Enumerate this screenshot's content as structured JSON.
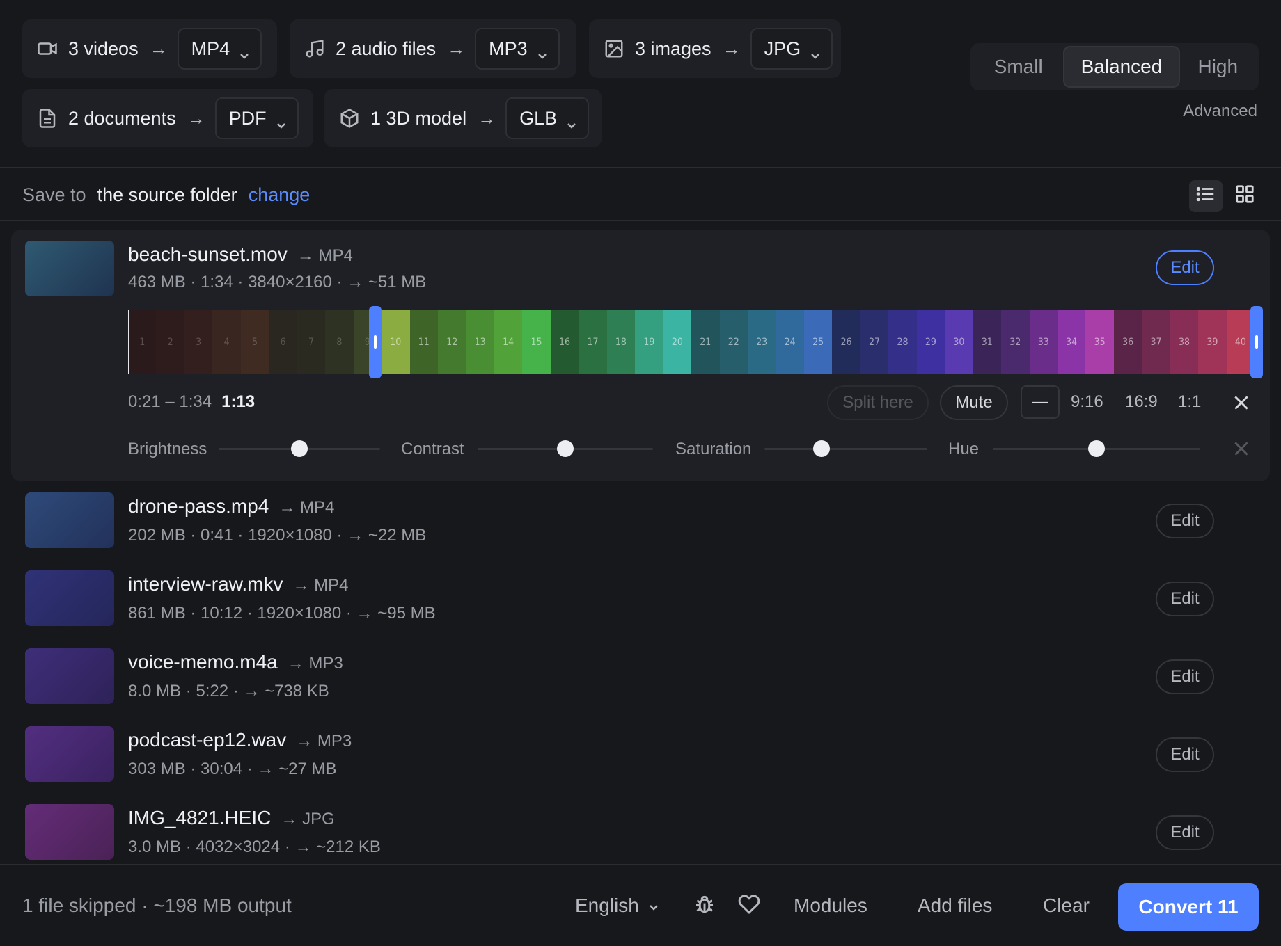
{
  "groups": [
    {
      "label": "3 videos",
      "arrow": "→",
      "format": "MP4",
      "icon": "video-icon"
    },
    {
      "label": "2 audio files",
      "arrow": "→",
      "format": "MP3",
      "icon": "music-note-icon"
    },
    {
      "label": "3 images",
      "arrow": "→",
      "format": "JPG",
      "icon": "image-icon"
    },
    {
      "label": "2 documents",
      "arrow": "→",
      "format": "PDF",
      "icon": "document-icon"
    },
    {
      "label": "1 3D model",
      "arrow": "→",
      "format": "GLB",
      "icon": "cube-icon"
    }
  ],
  "quality": {
    "options": [
      "Small",
      "Balanced",
      "High"
    ],
    "selected": "Balanced",
    "advanced": "Advanced"
  },
  "save": {
    "label": "Save to",
    "folder": "the source folder",
    "change": "change"
  },
  "files": [
    {
      "name": "beach-sunset.mov",
      "target": "→ MP4",
      "meta": "463 MB · 1:34 · 3840×2160 · → ~51 MB",
      "edit": "Edit",
      "thumb_color": "#2d4d6b",
      "expanded": true
    },
    {
      "name": "drone-pass.mp4",
      "target": "→ MP4",
      "meta": "202 MB · 0:41 · 1920×1080 · → ~22 MB",
      "edit": "Edit",
      "thumb_color": "#2b3f6e"
    },
    {
      "name": "interview-raw.mkv",
      "target": "→ MP4",
      "meta": "861 MB · 10:12 · 1920×1080 · → ~95 MB",
      "edit": "Edit",
      "thumb_color": "#2c2f6e"
    },
    {
      "name": "voice-memo.m4a",
      "target": "→ MP3",
      "meta": "8.0 MB · 5:22 · → ~738 KB",
      "edit": "Edit",
      "thumb_color": "#3a2a6a"
    },
    {
      "name": "podcast-ep12.wav",
      "target": "→ MP3",
      "meta": "303 MB · 30:04 · → ~27 MB",
      "edit": "Edit",
      "thumb_color": "#4a2a6c"
    },
    {
      "name": "IMG_4821.HEIC",
      "target": "→ JPG",
      "meta": "3.0 MB · 4032×3024 · → ~212 KB",
      "edit": "Edit",
      "thumb_color": "#5a2a62"
    }
  ],
  "editor": {
    "frames": [
      "1",
      "2",
      "3",
      "4",
      "5",
      "6",
      "7",
      "8",
      "9",
      "10",
      "11",
      "12",
      "13",
      "14",
      "15",
      "16",
      "17",
      "18",
      "19",
      "20",
      "21",
      "22",
      "23",
      "24",
      "25",
      "26",
      "27",
      "28",
      "29",
      "30",
      "31",
      "32",
      "33",
      "34",
      "35",
      "36",
      "37",
      "38",
      "39",
      "40"
    ],
    "frame_colors": [
      "#2a1a1c",
      "#2e1c1c",
      "#331f1d",
      "#3a2620",
      "#402b22",
      "#2a2620",
      "#2a2a20",
      "#2e3222",
      "#3a4428",
      "#8aac40",
      "#3e6428",
      "#447a2e",
      "#4a8e34",
      "#52a23a",
      "#46b24a",
      "#245a30",
      "#2a7040",
      "#2e8054",
      "#34a080",
      "#3cb4a4",
      "#22545c",
      "#265e6c",
      "#2a6a84",
      "#306a9c",
      "#3a6ab8",
      "#222c5a",
      "#2a2e6c",
      "#34308a",
      "#3e30a0",
      "#5a3ab0",
      "#3a2458",
      "#4a2a6c",
      "#6a2e8a",
      "#8a34a8",
      "#aa3ea8",
      "#5a2448",
      "#702a50",
      "#882e56",
      "#a03458",
      "#b83c56"
    ],
    "range": "0:21 – 1:34",
    "duration": "1:13",
    "split": "Split here",
    "mute": "Mute",
    "ratios": [
      "—",
      "9:16",
      "16:9",
      "1:1"
    ],
    "adjust": [
      {
        "label": "Brightness",
        "value": 0.5
      },
      {
        "label": "Contrast",
        "value": 0.5
      },
      {
        "label": "Saturation",
        "value": 0.35
      },
      {
        "label": "Hue",
        "value": 0.5
      }
    ]
  },
  "footer": {
    "status": "1 file skipped · ~198 MB output",
    "language": "English",
    "modules": "Modules",
    "add_files": "Add files",
    "clear": "Clear",
    "convert": "Convert 11"
  }
}
